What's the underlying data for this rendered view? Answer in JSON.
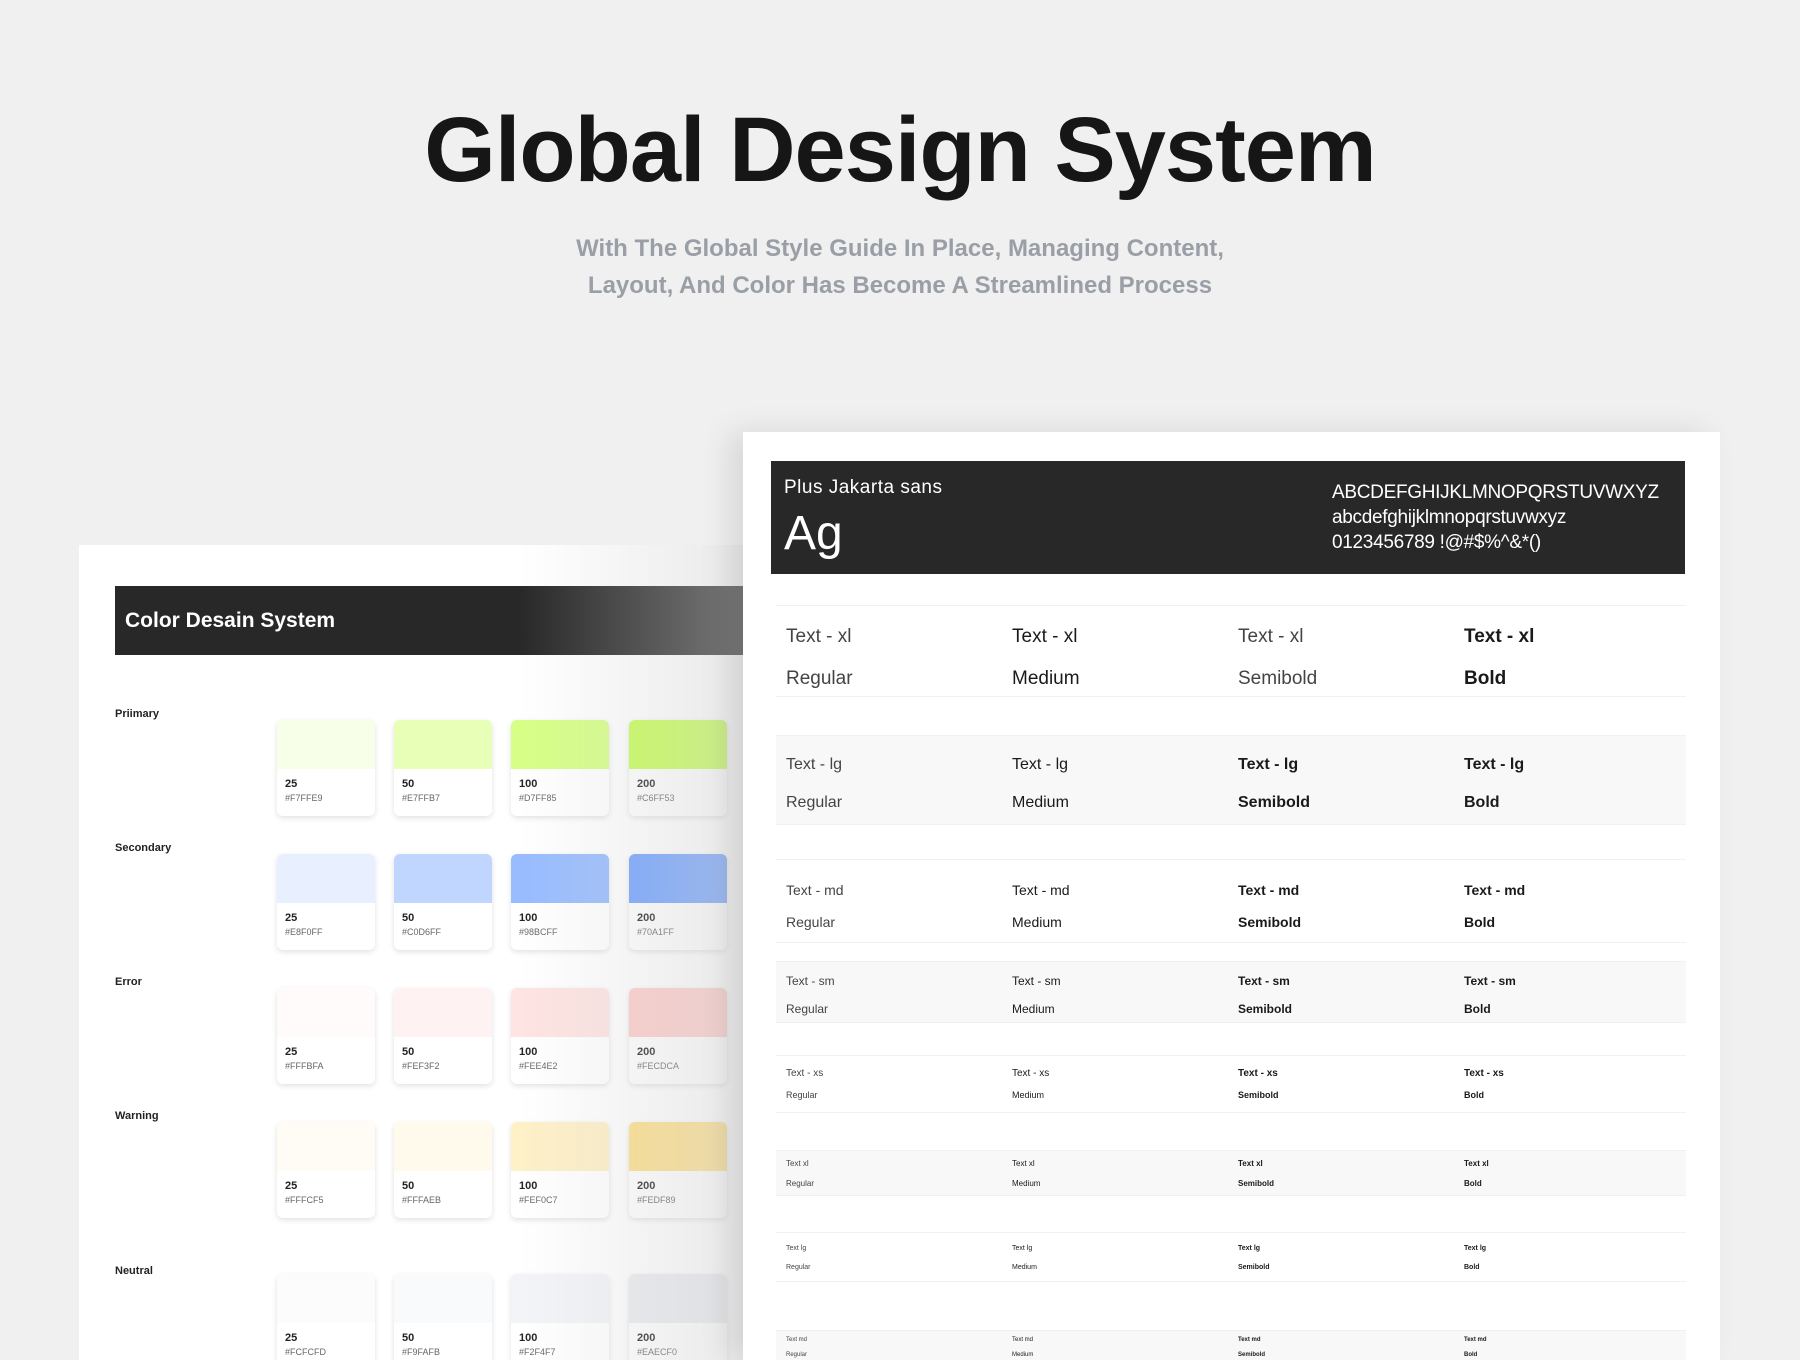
{
  "hero": {
    "title": "Global Design System",
    "subtitle_line1": "With The Global Style Guide In Place, Managing Content,",
    "subtitle_line2": "Layout, And Color Has Become A Streamlined Process"
  },
  "color_panel": {
    "title": "Color Desain System",
    "groups": [
      {
        "label": "Priimary",
        "swatches": [
          {
            "num": "25",
            "hex": "#F7FFE9"
          },
          {
            "num": "50",
            "hex": "#E7FFB7"
          },
          {
            "num": "100",
            "hex": "#D7FF85"
          },
          {
            "num": "200",
            "hex": "#C6FF53"
          }
        ]
      },
      {
        "label": "Secondary",
        "swatches": [
          {
            "num": "25",
            "hex": "#E8F0FF"
          },
          {
            "num": "50",
            "hex": "#C0D6FF"
          },
          {
            "num": "100",
            "hex": "#98BCFF"
          },
          {
            "num": "200",
            "hex": "#70A1FF"
          }
        ]
      },
      {
        "label": "Error",
        "swatches": [
          {
            "num": "25",
            "hex": "#FFFBFA"
          },
          {
            "num": "50",
            "hex": "#FEF3F2"
          },
          {
            "num": "100",
            "hex": "#FEE4E2"
          },
          {
            "num": "200",
            "hex": "#FECDCA"
          }
        ]
      },
      {
        "label": "Warning",
        "swatches": [
          {
            "num": "25",
            "hex": "#FFFCF5"
          },
          {
            "num": "50",
            "hex": "#FFFAEB"
          },
          {
            "num": "100",
            "hex": "#FEF0C7"
          },
          {
            "num": "200",
            "hex": "#FEDF89"
          }
        ]
      },
      {
        "label": "Neutral",
        "swatches": [
          {
            "num": "25",
            "hex": "#FCFCFD"
          },
          {
            "num": "50",
            "hex": "#F9FAFB"
          },
          {
            "num": "100",
            "hex": "#F2F4F7"
          },
          {
            "num": "200",
            "hex": "#EAECF0"
          }
        ]
      }
    ]
  },
  "type_panel": {
    "font_name": "Plus Jakarta sans",
    "sample": "Ag",
    "uppercase": "ABCDEFGHIJKLMNOPQRSTUVWXYZ",
    "lowercase": "abcdefghijklmnopqrstuvwxyz",
    "digits": "0123456789 !@#$%^&*()",
    "rows": [
      {
        "labels": [
          "Text - xl",
          "Text - xl",
          "Text - xl",
          "Text - xl"
        ],
        "weights": [
          "Regular",
          "Medium",
          "Semibold",
          "Bold"
        ]
      },
      {
        "labels": [
          "Text - lg",
          "Text - lg",
          "Text - lg",
          "Text - lg"
        ],
        "weights": [
          "Regular",
          "Medium",
          "Semibold",
          "Bold"
        ]
      },
      {
        "labels": [
          "Text - md",
          "Text - md",
          "Text - md",
          "Text - md"
        ],
        "weights": [
          "Regular",
          "Medium",
          "Semibold",
          "Bold"
        ]
      },
      {
        "labels": [
          "Text - sm",
          "Text - sm",
          "Text - sm",
          "Text - sm"
        ],
        "weights": [
          "Regular",
          "Medium",
          "Semibold",
          "Bold"
        ]
      },
      {
        "labels": [
          "Text - xs",
          "Text - xs",
          "Text - xs",
          "Text - xs"
        ],
        "weights": [
          "Regular",
          "Medium",
          "Semibold",
          "Bold"
        ]
      },
      {
        "labels": [
          "Text xl",
          "Text xl",
          "Text xl",
          "Text xl"
        ],
        "weights": [
          "Regular",
          "Medium",
          "Semibold",
          "Bold"
        ]
      },
      {
        "labels": [
          "Text lg",
          "Text lg",
          "Text lg",
          "Text lg"
        ],
        "weights": [
          "Regular",
          "Medium",
          "Semibold",
          "Bold"
        ]
      },
      {
        "labels": [
          "Text md",
          "Text md",
          "Text md",
          "Text md"
        ],
        "weights": [
          "Regular",
          "Medium",
          "Semibold",
          "Bold"
        ]
      }
    ]
  }
}
